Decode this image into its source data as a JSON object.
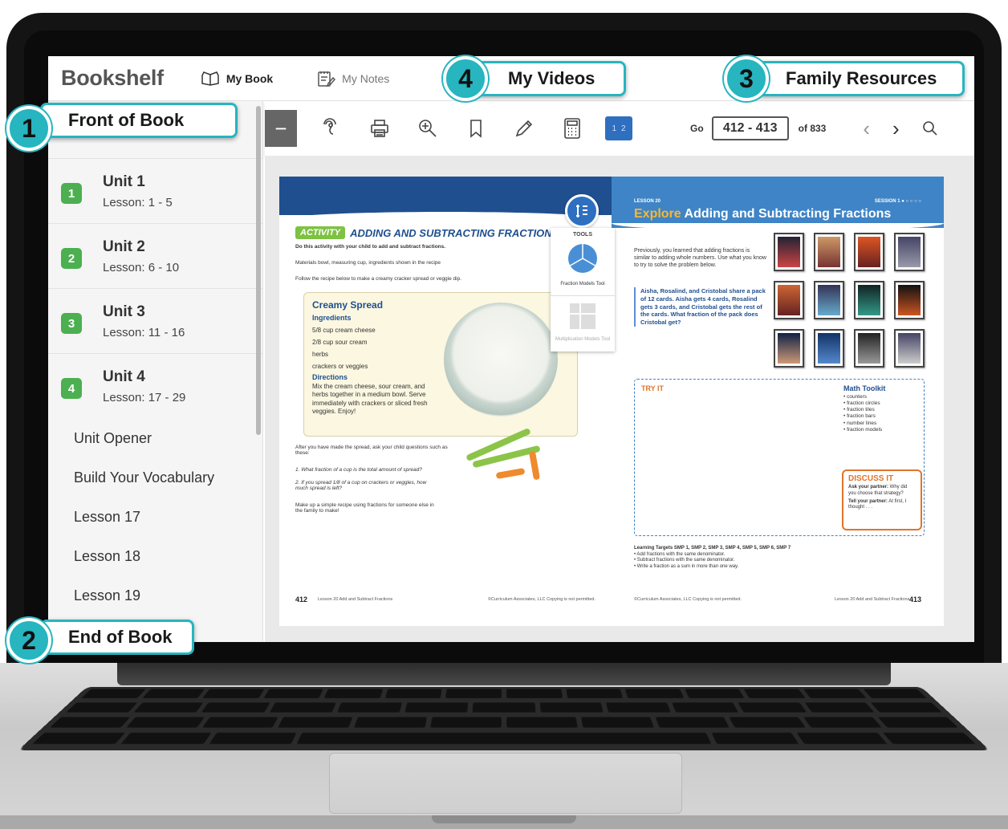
{
  "app": {
    "title": "Bookshelf"
  },
  "nav": {
    "my_book": "My Book",
    "my_notes": "My Notes"
  },
  "callouts": [
    {
      "num": "1",
      "label": "Front of Book"
    },
    {
      "num": "2",
      "label": "End of Book"
    },
    {
      "num": "3",
      "label": "Family Resources"
    },
    {
      "num": "4",
      "label": "My Videos"
    }
  ],
  "sidebar": {
    "units": [
      {
        "num": "1",
        "title": "Unit 1",
        "lessons": "Lesson: 1 - 5"
      },
      {
        "num": "2",
        "title": "Unit 2",
        "lessons": "Lesson: 6 - 10"
      },
      {
        "num": "3",
        "title": "Unit 3",
        "lessons": "Lesson: 11 - 16"
      },
      {
        "num": "4",
        "title": "Unit 4",
        "lessons": "Lesson: 17 - 29"
      }
    ],
    "unit4_items": [
      "Unit Opener",
      "Build Your Vocabulary",
      "Lesson 17",
      "Lesson 18",
      "Lesson 19"
    ]
  },
  "toolbar": {
    "minus": "−",
    "pages_view": [
      "1",
      "2"
    ],
    "go_label": "Go",
    "page_range": "412 - 413",
    "of_total": "of 833",
    "prev": "‹",
    "next": "›"
  },
  "tools_panel": {
    "button_label": "1̲E",
    "title": "TOOLS",
    "item1": "Fraction Models Tool",
    "item2": "Multiplication Models Tool"
  },
  "left_page": {
    "activity_pill": "ACTIVITY",
    "activity_title": "ADDING AND SUBTRACTING FRACTIONS",
    "intro": "Do this activity with your child to add and subtract fractions.",
    "materials": "Materials  bowl, measuring cup, ingredients shown in the recipe",
    "follow": "Follow the recipe below to make a creamy cracker spread or veggie dip.",
    "recipe_title": "Creamy Spread",
    "ingredients_title": "Ingredients",
    "ingredients": [
      "5/8 cup cream cheese",
      "2/8 cup sour cream",
      "herbs",
      "crackers or veggies"
    ],
    "directions_title": "Directions",
    "directions": "Mix the cream cheese, sour cream, and herbs together in a medium bowl. Serve immediately with crackers or sliced fresh veggies. Enjoy!",
    "after": "After you have made the spread, ask your child questions such as these:",
    "q1": "1. What fraction of a cup is the total amount of spread?",
    "q2": "2. If you spread 1/8 of a cup on crackers or veggies, how much spread is left?",
    "closing": "Make up a simple recipe using fractions for someone else in the family to make!",
    "page_num": "412",
    "footer_lesson": "Lesson 20  Add and Subtract Fractions",
    "footer_copy": "©Curriculum Associates, LLC   Copying is not permitted."
  },
  "right_page": {
    "lesson_tag": "LESSON 20",
    "session_tag": "SESSION 1 ● ○ ○ ○ ○",
    "title_accent": "Explore",
    "title_rest": " Adding and Subtracting Fractions",
    "intro": "Previously, you learned that adding fractions is similar to adding whole numbers. Use what you know to try to solve the problem below.",
    "problem": "Aisha, Rosalind, and Cristobal share a pack of 12 cards. Aisha gets 4 cards, Rosalind gets 3 cards, and Cristobal gets the rest of the cards. What fraction of the pack does Cristobal get?",
    "try_it": "TRY IT",
    "toolkit_title": "Math Toolkit",
    "toolkit_items": [
      "• counters",
      "• fraction circles",
      "• fraction tiles",
      "• fraction bars",
      "• number lines",
      "• fraction models"
    ],
    "discuss_title": "DISCUSS IT",
    "discuss_1_b": "Ask your partner:",
    "discuss_1": " Why did you choose that strategy?",
    "discuss_2_b": "Tell your partner:",
    "discuss_2": " At first, I thought . . .",
    "lt_title": "Learning Targets   SMP 1, SMP 2, SMP 3, SMP 4, SMP 5, SMP 6, SMP 7",
    "lt_items": [
      "• Add fractions with the same denominator.",
      "• Subtract fractions with the same denominator.",
      "• Write a fraction as a sum in more than one way."
    ],
    "footer_copy": "©Curriculum Associates, LLC   Copying is not permitted.",
    "footer_lesson": "Lesson 20  Add and Subtract Fractions",
    "page_num": "413"
  },
  "colors": {
    "accent": "#27b5c0",
    "unit_badge": "#4caf50",
    "page_blue": "#1f4f8f"
  }
}
